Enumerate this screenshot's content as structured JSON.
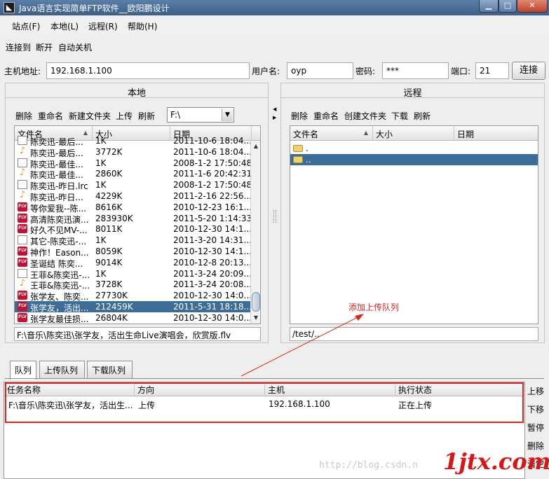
{
  "window": {
    "title": "Java语言实现简单FTP软件__欧阳鹏设计"
  },
  "menu": [
    "站点(F)",
    "本地(L)",
    "远程(R)",
    "帮助(H)"
  ],
  "toolbar": [
    "连接到",
    "断开",
    "自动关机"
  ],
  "connection": {
    "host_label": "主机地址:",
    "host_value": "192.168.1.100",
    "user_label": "用户名:",
    "user_value": "oyp",
    "pass_label": "密码:",
    "pass_value": "***",
    "port_label": "端口:",
    "port_value": "21",
    "connect_label": "连接"
  },
  "local": {
    "title": "本地",
    "tools": [
      "删除",
      "重命名",
      "新建文件夹",
      "上传",
      "刷新"
    ],
    "drive": "F:\\",
    "columns": [
      "文件名",
      "大小",
      "日期"
    ],
    "rows": [
      {
        "icon": "doc",
        "name": "陈奕迅-最后...",
        "size": "1K",
        "date": "2011-10-6 18:04..."
      },
      {
        "icon": "music",
        "name": "陈奕迅-最后...",
        "size": "3772K",
        "date": "2011-10-6 18:04..."
      },
      {
        "icon": "doc",
        "name": "陈奕迅-最佳...",
        "size": "1K",
        "date": "2008-1-2 17:50:48"
      },
      {
        "icon": "music",
        "name": "陈奕迅-最佳...",
        "size": "2860K",
        "date": "2011-1-6 20:42:31"
      },
      {
        "icon": "doc",
        "name": "陈奕迅-昨日.lrc",
        "size": "1K",
        "date": "2008-1-2 17:50:48"
      },
      {
        "icon": "music",
        "name": "陈奕迅-昨日...",
        "size": "4229K",
        "date": "2011-2-16 22:56..."
      },
      {
        "icon": "flv",
        "name": "等你爱我--陈...",
        "size": "8616K",
        "date": "2010-12-23 16:1..."
      },
      {
        "icon": "flv",
        "name": "高清陈奕迅演...",
        "size": "283930K",
        "date": "2011-5-20 1:14:33"
      },
      {
        "icon": "flv",
        "name": "好久不见MV-...",
        "size": "8011K",
        "date": "2010-12-30 14:1..."
      },
      {
        "icon": "doc",
        "name": "其它-陈奕迅-...",
        "size": "1K",
        "date": "2011-3-20 14:31..."
      },
      {
        "icon": "flv",
        "name": "神作！Eason...",
        "size": "8059K",
        "date": "2010-12-30 14:1..."
      },
      {
        "icon": "flv",
        "name": "圣诞结 陈奕...",
        "size": "9014K",
        "date": "2010-12-8 20:13..."
      },
      {
        "icon": "doc",
        "name": "王菲&陈奕迅-...",
        "size": "1K",
        "date": "2011-3-24 20:09..."
      },
      {
        "icon": "music",
        "name": "王菲&陈奕迅-...",
        "size": "3728K",
        "date": "2011-3-24 20:08..."
      },
      {
        "icon": "flv",
        "name": "张学友、陈奕...",
        "size": "27730K",
        "date": "2010-12-30 14:0..."
      },
      {
        "icon": "flv",
        "name": "张学友，活出...",
        "size": "212459K",
        "date": "2011-5-31 18:18...",
        "selected": true
      },
      {
        "icon": "flv",
        "name": "张学友最佳损...",
        "size": "26804K",
        "date": "2010-12-30 14:0..."
      }
    ],
    "path": "F:\\音乐\\陈奕迅\\张学友，活出生命Live演唱会，欣赏版.flv"
  },
  "remote": {
    "title": "远程",
    "tools": [
      "删除",
      "重命名",
      "创建文件夹",
      "下载",
      "刷新"
    ],
    "columns": [
      "文件名",
      "大小",
      "日期"
    ],
    "rows": [
      {
        "icon": "folder",
        "name": ".",
        "selected": false
      },
      {
        "icon": "folder",
        "name": "..",
        "selected": true
      }
    ],
    "path": "/test/.."
  },
  "annotation": "添加上传队列",
  "queue": {
    "tabs": [
      "队列",
      "上传队列",
      "下载队列"
    ],
    "columns": [
      "任务名称",
      "方向",
      "主机",
      "执行状态"
    ],
    "rows": [
      {
        "name": "F:\\音乐\\陈奕迅\\张学友，活出生...",
        "direction": "上传",
        "host": "192.168.1.100",
        "status": "正在上传"
      }
    ],
    "actions": [
      "上移",
      "下移",
      "暂停",
      "删除",
      "清空"
    ]
  },
  "watermark": "http://blog.csdn.n",
  "logo": "1jtx.com"
}
